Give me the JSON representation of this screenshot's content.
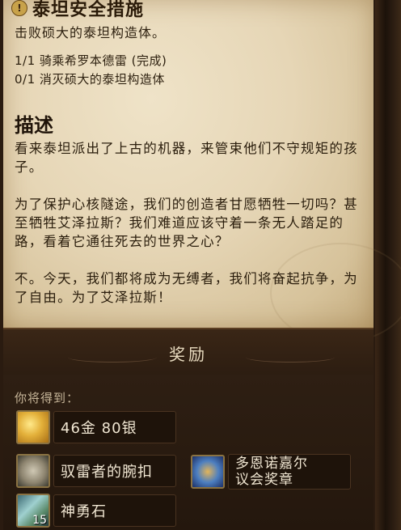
{
  "quest": {
    "title": "泰坦安全措施",
    "title_icon": "!",
    "objective": "击败硕大的泰坦构造体。",
    "objectives_list": [
      "1/1 骑乘希罗本德雷 (完成)",
      "0/1 消灭硕大的泰坦构造体"
    ]
  },
  "description": {
    "heading": "描述",
    "paragraphs": [
      "看来泰坦派出了上古的机器，来管束他们不守规矩的孩子。",
      "为了保护心核隧途，我们的创造者甘愿牺牲一切吗？甚至牺牲艾泽拉斯？我们难道应该守着一条无人踏足的路，看着它通往死去的世界之心？",
      "不。今天，我们都将成为无缚者，我们将奋起抗争，为了自由。为了艾泽拉斯！"
    ]
  },
  "rewards": {
    "title": "奖励",
    "receive_label": "你将得到：",
    "money": "46金 80银",
    "items": [
      {
        "name": "驭雷者的腕扣",
        "icon": "bracer-icon"
      },
      {
        "name": "多恩诺嘉尔议会奖章",
        "icon": "medal-icon"
      },
      {
        "name": "神勇石",
        "icon": "valor-stone-icon",
        "count": "15"
      }
    ],
    "medal_line1": "多恩诺嘉尔",
    "medal_line2": "议会奖章"
  },
  "colors": {
    "parchment": "#e6d6b6",
    "frame": "#2a1b10",
    "reward_text": "#f0e6d2"
  }
}
